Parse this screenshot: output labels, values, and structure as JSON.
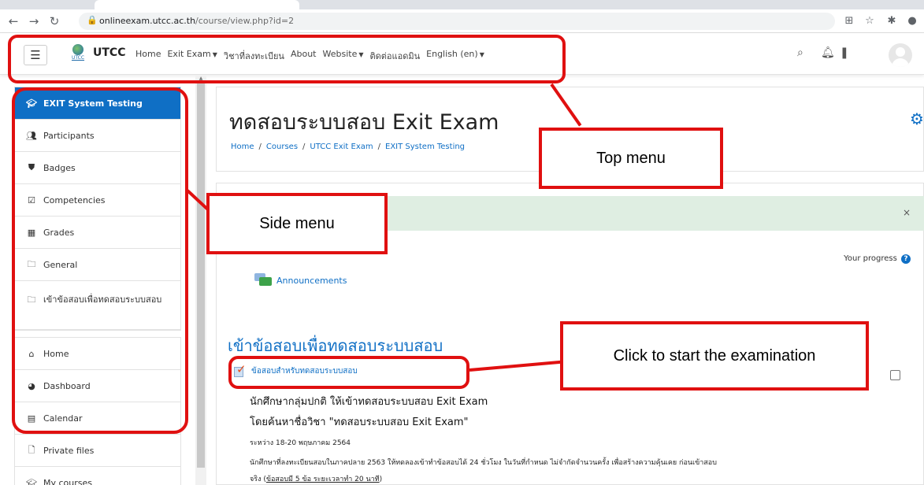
{
  "browser": {
    "url_host": "onlineexam.utcc.ac.th",
    "url_path": "/course/view.php?id=2"
  },
  "topbar": {
    "brand": "UTCC",
    "logo_sub": "UTCC",
    "nav": [
      {
        "label": "Home",
        "dropdown": false
      },
      {
        "label": "Exit Exam",
        "dropdown": true
      },
      {
        "label": "วิชาที่ลงทะเบียน",
        "dropdown": false
      },
      {
        "label": "About",
        "dropdown": false
      },
      {
        "label": "Website",
        "dropdown": true
      },
      {
        "label": "ติดต่อแอดมิน",
        "dropdown": false
      },
      {
        "label": "English (en)",
        "dropdown": true
      }
    ],
    "icons": [
      "search-icon",
      "bell-icon",
      "chat-icon"
    ]
  },
  "sidebar": {
    "course_items": [
      {
        "label": "EXIT System Testing",
        "icon": "graduation-cap-icon"
      },
      {
        "label": "Participants",
        "icon": "users-icon"
      },
      {
        "label": "Badges",
        "icon": "badge-icon"
      },
      {
        "label": "Competencies",
        "icon": "checkbox-icon"
      },
      {
        "label": "Grades",
        "icon": "table-icon"
      },
      {
        "label": "General",
        "icon": "folder-icon"
      },
      {
        "label": "เข้าข้อสอบเพื่อทดสอบระบบสอบ",
        "icon": "folder-icon"
      }
    ],
    "site_items": [
      {
        "label": "Home",
        "icon": "home-icon"
      },
      {
        "label": "Dashboard",
        "icon": "dashboard-icon"
      },
      {
        "label": "Calendar",
        "icon": "calendar-icon"
      },
      {
        "label": "Private files",
        "icon": "file-icon"
      },
      {
        "label": "My courses",
        "icon": "graduation-cap-icon"
      }
    ]
  },
  "header": {
    "title": "ทดสอบระบบสอบ Exit Exam",
    "breadcrumb": [
      "Home",
      "Courses",
      "UTCC Exit Exam",
      "EXIT System Testing"
    ]
  },
  "content": {
    "alert_close": "×",
    "progress_label": "Your progress",
    "progress_help": "?",
    "announcements": "Announcements",
    "section_title": "เข้าข้อสอบเพื่อทดสอบระบบสอบ",
    "quiz_link": "ข้อสอบสำหรับทดสอบระบบสอบ",
    "desc_line1": "นักศึกษากลุ่มปกติ ให้เข้าทดสอบระบบสอบ Exit Exam",
    "desc_line2": "โดยค้นหาชื่อวิชา \"ทดสอบระบบสอบ Exit Exam\"",
    "desc_line3": "ระหว่าง 18-20 พฤษภาคม 2564",
    "desc_line4": "นักศึกษาที่ลงทะเบียนสอบในภาคปลาย 2563 ให้ทดลองเข้าทำข้อสอบได้ 24 ชั่วโมง ในวันที่กำหนด ไม่จำกัดจำนวนครั้ง เพื่อสร้างความคุ้นเคย ก่อนเข้าสอบ",
    "desc_line5_prefix": "จริง (",
    "desc_line5_link": "ข้อสอบมี 5 ข้อ ระยะเวลาทำ 20 นาที",
    "desc_line5_suffix": ")"
  },
  "annotations": {
    "top_menu": "Top menu",
    "side_menu": "Side menu",
    "start_exam": "Click to start the examination",
    "color": "#e01010"
  }
}
